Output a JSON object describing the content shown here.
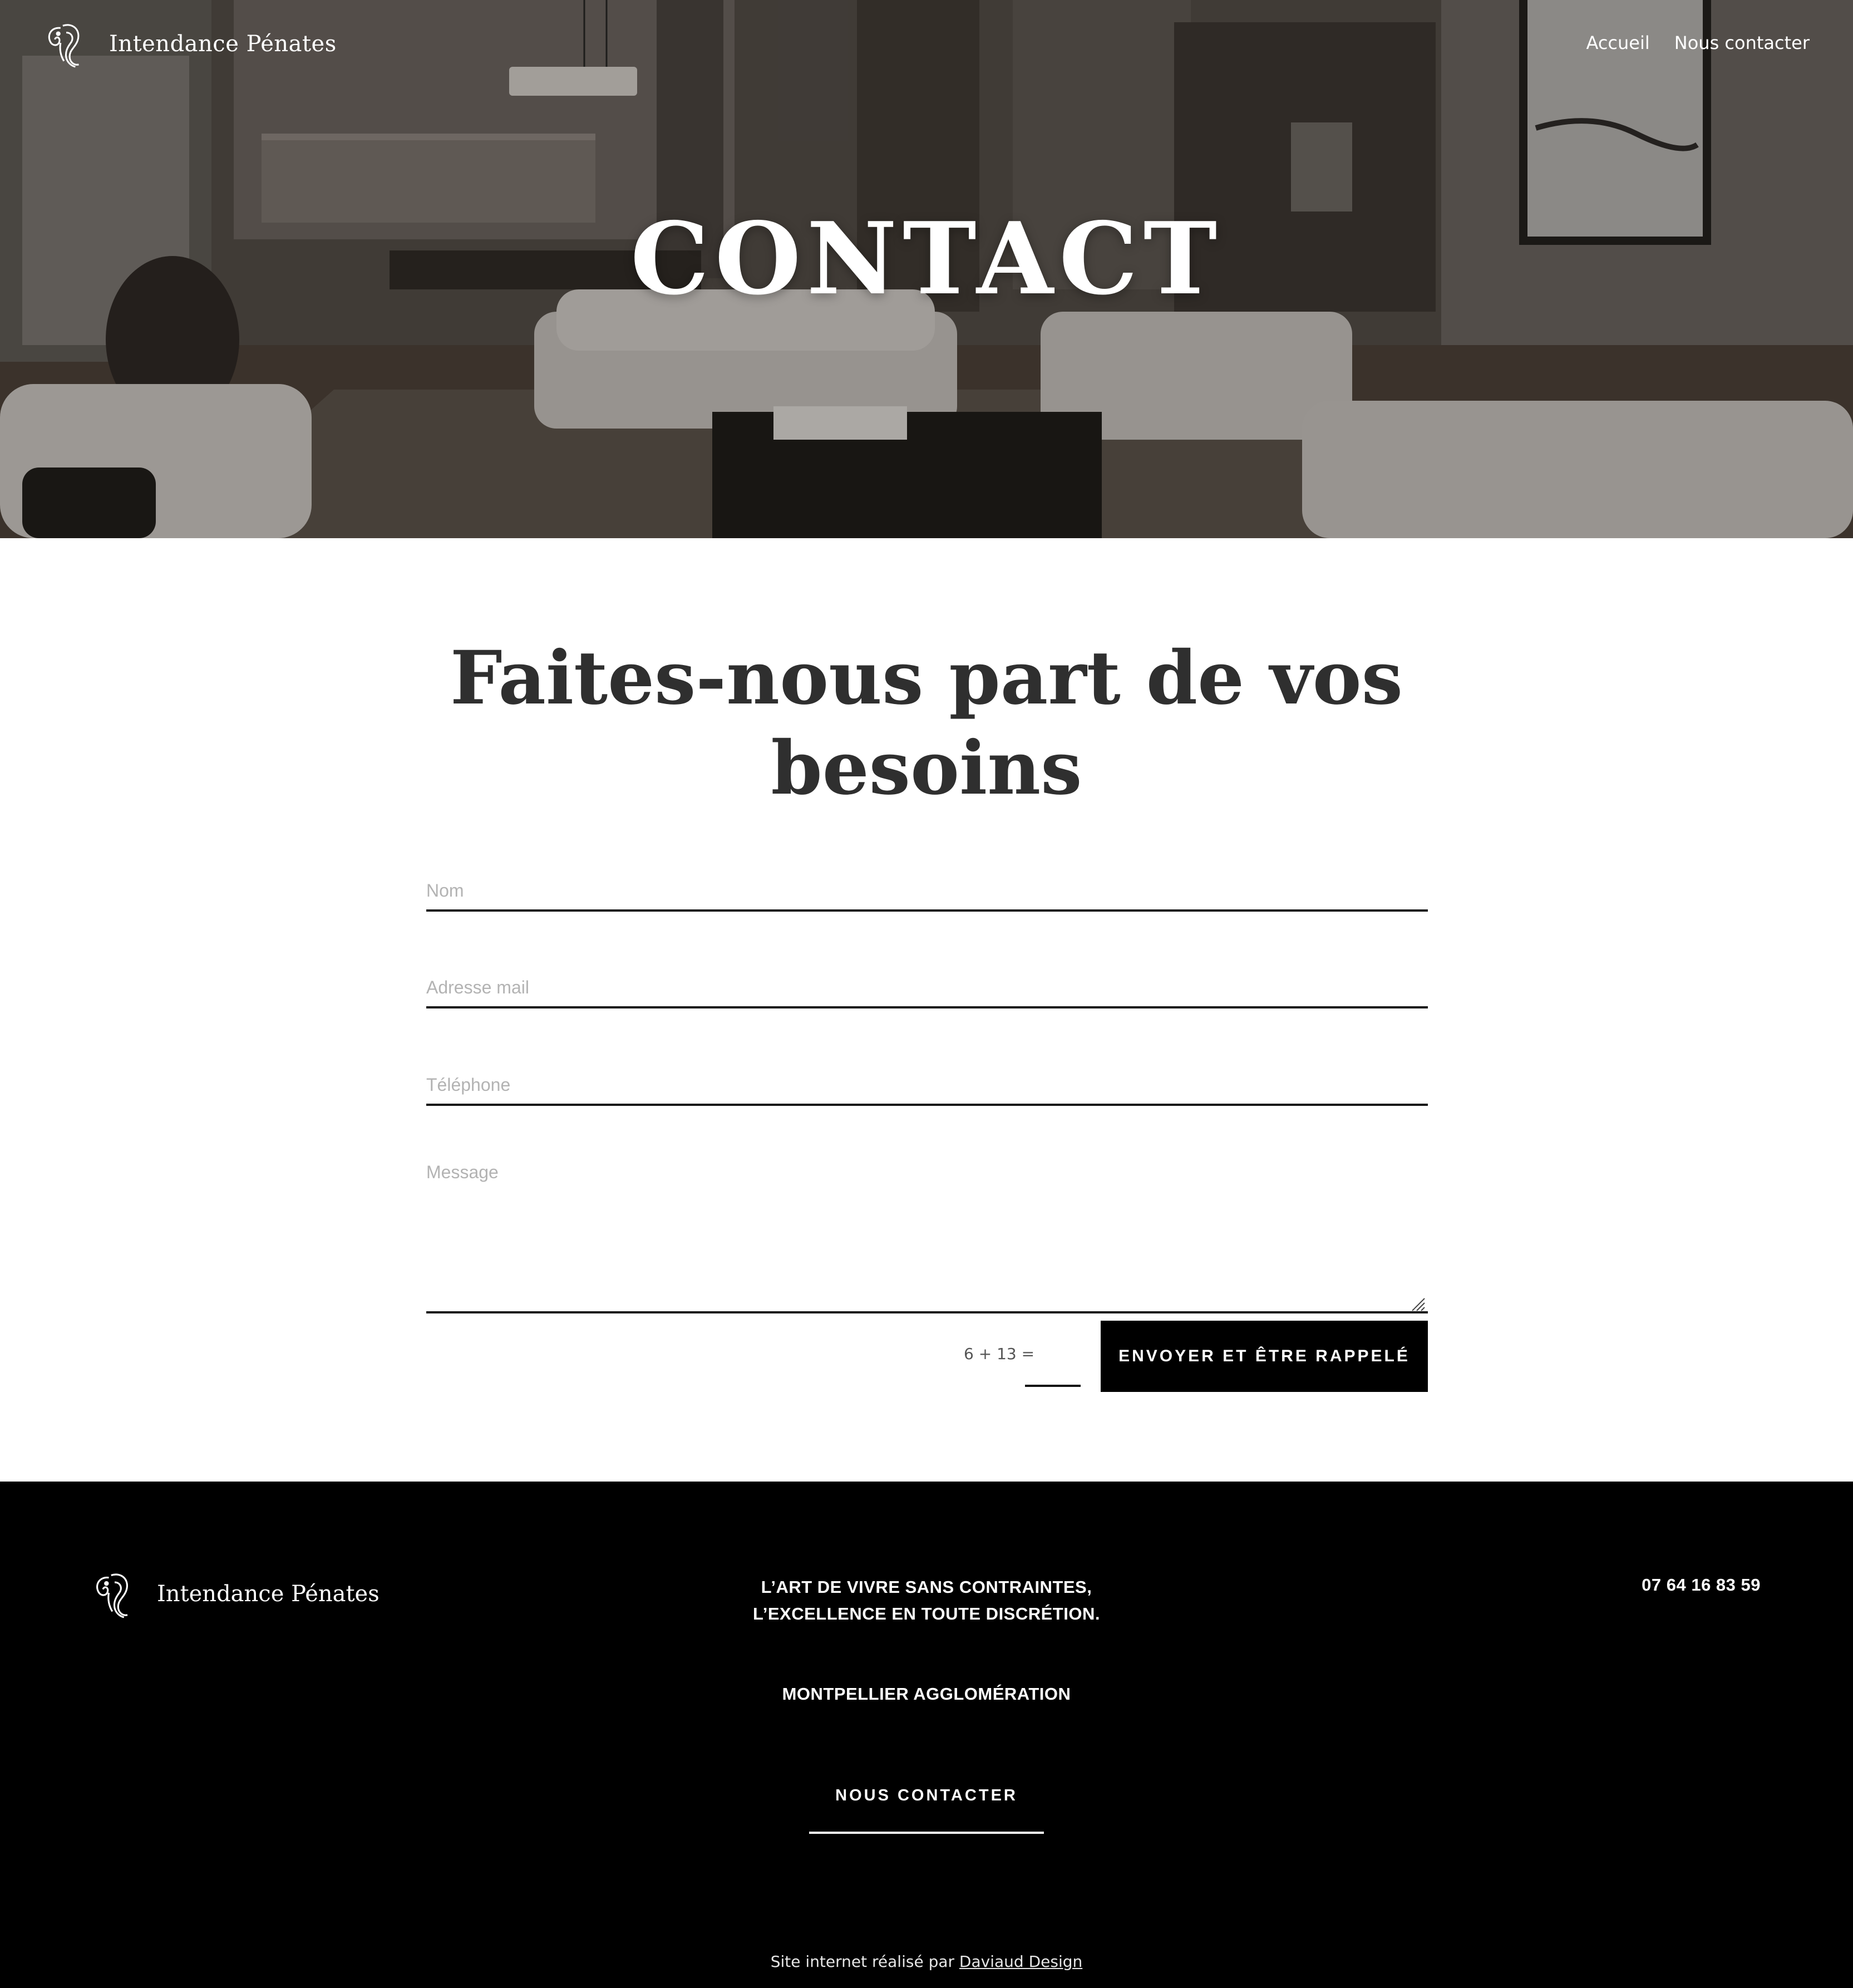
{
  "header": {
    "brand_name": "Intendance Pénates",
    "nav": [
      {
        "label": "Accueil"
      },
      {
        "label": "Nous contacter"
      }
    ]
  },
  "hero": {
    "title": "CONTACT"
  },
  "form": {
    "title_line1": "Faites-nous part de vos",
    "title_line2": "besoins",
    "name_placeholder": "Nom",
    "email_placeholder": "Adresse mail",
    "phone_placeholder": "Téléphone",
    "message_placeholder": "Message",
    "captcha_label": "6 + 13 =",
    "submit_label": "ENVOYER ET ÊTRE RAPPELÉ"
  },
  "footer": {
    "brand_name": "Intendance Pénates",
    "tagline_line1": "L’ART DE VIVRE SANS CONTRAINTES,",
    "tagline_line2": "L’EXCELLENCE EN TOUTE DISCRÉTION.",
    "location": "MONTPELLIER AGGLOMÉRATION",
    "contact_link": "NOUS CONTACTER",
    "phone": "07 64 16 83 59",
    "credit_prefix": "Site internet réalisé par",
    "credit_link": "Daviaud Design"
  },
  "colors": {
    "footer_bg": "#000000",
    "button_bg": "#000000",
    "title_text": "#2f2f2f",
    "placeholder": "#b3b3b3"
  }
}
